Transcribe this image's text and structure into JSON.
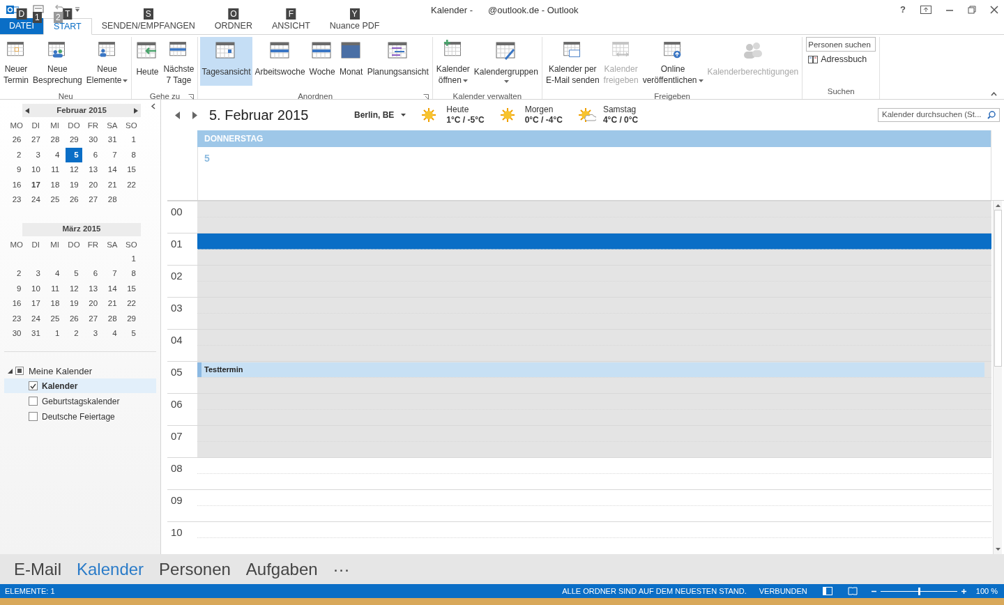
{
  "window": {
    "title_left": "Kalender -",
    "title_right": "@outlook.de - Outlook",
    "quick_access_tips": [
      "1",
      "2"
    ],
    "help": "?"
  },
  "tabs": [
    {
      "label": "DATEI",
      "kind": "file",
      "selected": false,
      "key_tip": "D"
    },
    {
      "label": "START",
      "kind": "tab",
      "selected": true,
      "key_tip": "T"
    },
    {
      "label": "SENDEN/EMPFANGEN",
      "kind": "tab",
      "selected": false,
      "key_tip": "S"
    },
    {
      "label": "ORDNER",
      "kind": "tab",
      "selected": false,
      "key_tip": "O"
    },
    {
      "label": "ANSICHT",
      "kind": "tab",
      "selected": false,
      "key_tip": "F"
    },
    {
      "label": "Nuance PDF",
      "kind": "tab",
      "selected": false,
      "key_tip": "Y"
    }
  ],
  "ribbon": [
    {
      "label": "Neu",
      "launcher": false,
      "buttons": [
        {
          "lines": [
            "Neuer",
            "Termin"
          ],
          "kind": "calendar",
          "disabled": false,
          "dropdown": false,
          "selected": false
        },
        {
          "lines": [
            "Neue",
            "Besprechung"
          ],
          "kind": "meeting",
          "disabled": false,
          "dropdown": false,
          "selected": false
        },
        {
          "lines": [
            "Neue",
            "Elemente"
          ],
          "kind": "items",
          "disabled": false,
          "dropdown": true,
          "selected": false
        }
      ]
    },
    {
      "label": "Gehe zu",
      "launcher": true,
      "buttons": [
        {
          "lines": [
            "Heute"
          ],
          "kind": "today",
          "disabled": false,
          "dropdown": false,
          "selected": false
        },
        {
          "lines": [
            "Nächste",
            "7 Tage"
          ],
          "kind": "week",
          "disabled": false,
          "dropdown": false,
          "selected": false
        }
      ]
    },
    {
      "label": "Anordnen",
      "launcher": true,
      "buttons": [
        {
          "lines": [
            "Tagesansicht"
          ],
          "kind": "day",
          "disabled": false,
          "dropdown": false,
          "selected": true
        },
        {
          "lines": [
            "Arbeitswoche"
          ],
          "kind": "week",
          "disabled": false,
          "dropdown": false,
          "selected": false
        },
        {
          "lines": [
            "Woche"
          ],
          "kind": "week",
          "disabled": false,
          "dropdown": false,
          "selected": false
        },
        {
          "lines": [
            "Monat"
          ],
          "kind": "month",
          "disabled": false,
          "dropdown": false,
          "selected": false
        },
        {
          "lines": [
            "Planungsansicht"
          ],
          "kind": "schedule",
          "disabled": false,
          "dropdown": false,
          "selected": false
        }
      ]
    },
    {
      "label": "Kalender verwalten",
      "launcher": false,
      "buttons": [
        {
          "lines": [
            "Kalender",
            "öffnen"
          ],
          "kind": "add",
          "disabled": false,
          "dropdown": true,
          "selected": false
        },
        {
          "lines": [
            "Kalendergruppen"
          ],
          "kind": "edit",
          "disabled": false,
          "dropdown": true,
          "selected": false
        }
      ]
    },
    {
      "label": "Freigeben",
      "launcher": false,
      "buttons": [
        {
          "lines": [
            "Kalender per",
            "E-Mail senden"
          ],
          "kind": "mail",
          "disabled": false,
          "dropdown": false,
          "selected": false
        },
        {
          "lines": [
            "Kalender",
            "freigeben"
          ],
          "kind": "share",
          "disabled": true,
          "dropdown": false,
          "selected": false
        },
        {
          "lines": [
            "Online",
            "veröffentlichen"
          ],
          "kind": "publish",
          "disabled": false,
          "dropdown": true,
          "selected": false
        },
        {
          "lines": [
            "Kalenderberechtigungen"
          ],
          "kind": "permissions",
          "disabled": true,
          "dropdown": false,
          "selected": false
        }
      ]
    }
  ],
  "search_group": {
    "label": "Suchen",
    "people_search": {
      "placeholder": "Personen suchen"
    },
    "address_book": "Adressbuch"
  },
  "sidebar": {
    "months": [
      {
        "title": "Februar 2015",
        "nav": true,
        "weekdays": [
          "MO",
          "DI",
          "MI",
          "DO",
          "FR",
          "SA",
          "SO"
        ],
        "weeks": [
          [
            {
              "day": "26",
              "selected": false,
              "bold": false
            },
            {
              "day": "27",
              "selected": false,
              "bold": false
            },
            {
              "day": "28",
              "selected": false,
              "bold": false
            },
            {
              "day": "29",
              "selected": false,
              "bold": false
            },
            {
              "day": "30",
              "selected": false,
              "bold": false
            },
            {
              "day": "31",
              "selected": false,
              "bold": false
            },
            {
              "day": "1",
              "selected": false,
              "bold": false
            }
          ],
          [
            {
              "day": "2",
              "selected": false,
              "bold": false
            },
            {
              "day": "3",
              "selected": false,
              "bold": false
            },
            {
              "day": "4",
              "selected": false,
              "bold": false
            },
            {
              "day": "5",
              "selected": true,
              "bold": true
            },
            {
              "day": "6",
              "selected": false,
              "bold": false
            },
            {
              "day": "7",
              "selected": false,
              "bold": false
            },
            {
              "day": "8",
              "selected": false,
              "bold": false
            }
          ],
          [
            {
              "day": "9",
              "selected": false,
              "bold": false
            },
            {
              "day": "10",
              "selected": false,
              "bold": false
            },
            {
              "day": "11",
              "selected": false,
              "bold": false
            },
            {
              "day": "12",
              "selected": false,
              "bold": false
            },
            {
              "day": "13",
              "selected": false,
              "bold": false
            },
            {
              "day": "14",
              "selected": false,
              "bold": false
            },
            {
              "day": "15",
              "selected": false,
              "bold": false
            }
          ],
          [
            {
              "day": "16",
              "selected": false,
              "bold": false
            },
            {
              "day": "17",
              "selected": false,
              "bold": true
            },
            {
              "day": "18",
              "selected": false,
              "bold": false
            },
            {
              "day": "19",
              "selected": false,
              "bold": false
            },
            {
              "day": "20",
              "selected": false,
              "bold": false
            },
            {
              "day": "21",
              "selected": false,
              "bold": false
            },
            {
              "day": "22",
              "selected": false,
              "bold": false
            }
          ],
          [
            {
              "day": "23",
              "selected": false,
              "bold": false
            },
            {
              "day": "24",
              "selected": false,
              "bold": false
            },
            {
              "day": "25",
              "selected": false,
              "bold": false
            },
            {
              "day": "26",
              "selected": false,
              "bold": false
            },
            {
              "day": "27",
              "selected": false,
              "bold": false
            },
            {
              "day": "28",
              "selected": false,
              "bold": false
            }
          ]
        ]
      },
      {
        "title": "März 2015",
        "nav": false,
        "weekdays": [
          "MO",
          "DI",
          "MI",
          "DO",
          "FR",
          "SA",
          "SO"
        ],
        "weeks": [
          [
            {
              "day": "1",
              "selected": false,
              "bold": false
            }
          ],
          [
            {
              "day": "2",
              "selected": false,
              "bold": false
            },
            {
              "day": "3",
              "selected": false,
              "bold": false
            },
            {
              "day": "4",
              "selected": false,
              "bold": false
            },
            {
              "day": "5",
              "selected": false,
              "bold": false
            },
            {
              "day": "6",
              "selected": false,
              "bold": false
            },
            {
              "day": "7",
              "selected": false,
              "bold": false
            },
            {
              "day": "8",
              "selected": false,
              "bold": false
            }
          ],
          [
            {
              "day": "9",
              "selected": false,
              "bold": false
            },
            {
              "day": "10",
              "selected": false,
              "bold": false
            },
            {
              "day": "11",
              "selected": false,
              "bold": false
            },
            {
              "day": "12",
              "selected": false,
              "bold": false
            },
            {
              "day": "13",
              "selected": false,
              "bold": false
            },
            {
              "day": "14",
              "selected": false,
              "bold": false
            },
            {
              "day": "15",
              "selected": false,
              "bold": false
            }
          ],
          [
            {
              "day": "16",
              "selected": false,
              "bold": false
            },
            {
              "day": "17",
              "selected": false,
              "bold": false
            },
            {
              "day": "18",
              "selected": false,
              "bold": false
            },
            {
              "day": "19",
              "selected": false,
              "bold": false
            },
            {
              "day": "20",
              "selected": false,
              "bold": false
            },
            {
              "day": "21",
              "selected": false,
              "bold": false
            },
            {
              "day": "22",
              "selected": false,
              "bold": false
            }
          ],
          [
            {
              "day": "23",
              "selected": false,
              "bold": false
            },
            {
              "day": "24",
              "selected": false,
              "bold": false
            },
            {
              "day": "25",
              "selected": false,
              "bold": false
            },
            {
              "day": "26",
              "selected": false,
              "bold": false
            },
            {
              "day": "27",
              "selected": false,
              "bold": false
            },
            {
              "day": "28",
              "selected": false,
              "bold": false
            },
            {
              "day": "29",
              "selected": false,
              "bold": false
            }
          ],
          [
            {
              "day": "30",
              "selected": false,
              "bold": false
            },
            {
              "day": "31",
              "selected": false,
              "bold": false
            },
            {
              "day": "1",
              "selected": false,
              "bold": false
            },
            {
              "day": "2",
              "selected": false,
              "bold": false
            },
            {
              "day": "3",
              "selected": false,
              "bold": false
            },
            {
              "day": "4",
              "selected": false,
              "bold": false
            },
            {
              "day": "5",
              "selected": false,
              "bold": false
            }
          ]
        ]
      }
    ],
    "calendar_group": {
      "label": "Meine Kalender",
      "expanded": true,
      "mixed": true,
      "items": [
        {
          "label": "Kalender",
          "checked": true,
          "selected": true
        },
        {
          "label": "Geburtstagskalender",
          "checked": false,
          "selected": false
        },
        {
          "label": "Deutsche Feiertage",
          "checked": false,
          "selected": false
        }
      ]
    }
  },
  "day_view": {
    "date": "5. Februar 2015",
    "location": "Berlin, BE",
    "weather": [
      {
        "label": "Heute",
        "temp": "1°C / -5°C",
        "kind": "sun"
      },
      {
        "label": "Morgen",
        "temp": "0°C / -4°C",
        "kind": "sun"
      },
      {
        "label": "Samstag",
        "temp": "4°C / 0°C",
        "kind": "partly_cloudy"
      }
    ],
    "search": {
      "placeholder": "Kalender durchsuchen (St..."
    },
    "weekday": "DONNERSTAG",
    "day_number": "5",
    "hours": [
      {
        "label": "00",
        "working": false,
        "selected_slot": false
      },
      {
        "label": "01",
        "working": false,
        "selected_slot": true
      },
      {
        "label": "02",
        "working": false,
        "selected_slot": false
      },
      {
        "label": "03",
        "working": false,
        "selected_slot": false
      },
      {
        "label": "04",
        "working": false,
        "selected_slot": false
      },
      {
        "label": "05",
        "working": false,
        "selected_slot": false,
        "appointments": [
          {
            "title": "Testtermin"
          }
        ]
      },
      {
        "label": "06",
        "working": false,
        "selected_slot": false
      },
      {
        "label": "07",
        "working": false,
        "selected_slot": false
      },
      {
        "label": "08",
        "working": true,
        "selected_slot": false
      },
      {
        "label": "09",
        "working": true,
        "selected_slot": false
      },
      {
        "label": "10",
        "working": true,
        "selected_slot": false
      }
    ]
  },
  "nav": [
    {
      "label": "E-Mail",
      "selected": false
    },
    {
      "label": "Kalender",
      "selected": true
    },
    {
      "label": "Personen",
      "selected": false
    },
    {
      "label": "Aufgaben",
      "selected": false
    },
    {
      "label": "···",
      "selected": false
    }
  ],
  "status_bar": {
    "left": "ELEMENTE: 1",
    "sync": "ALLE ORDNER SIND AUF DEM NEUESTEN STAND.",
    "connection": "VERBUNDEN",
    "zoom": {
      "level": 0.5,
      "reading": "100 %"
    }
  }
}
